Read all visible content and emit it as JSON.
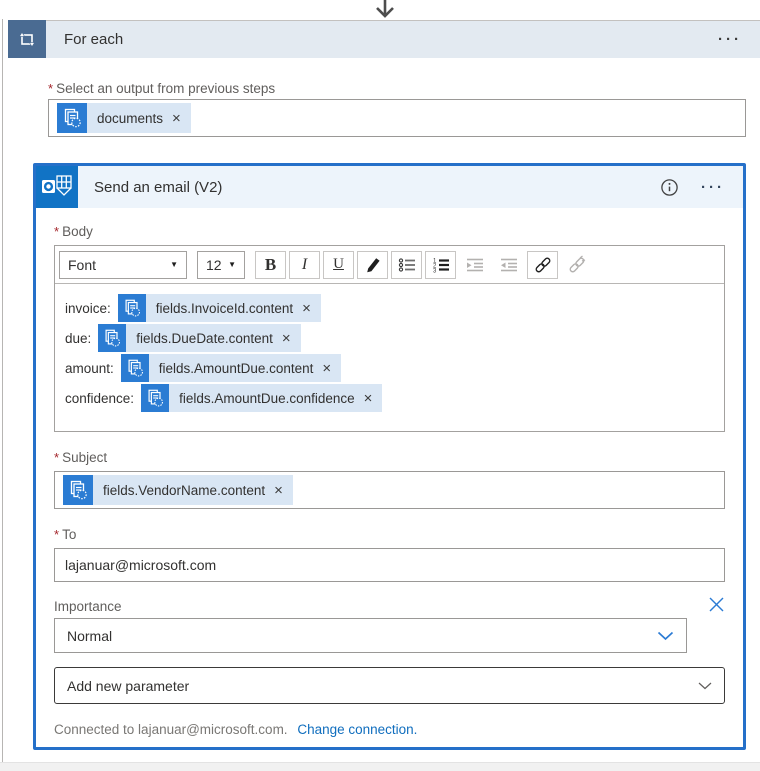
{
  "glyphs": {
    "caret_down": "▼",
    "ellipsis": "···",
    "dismiss": "×",
    "required": "*"
  },
  "for_each": {
    "title": "For each",
    "output_label": "Select an output from previous steps",
    "token": {
      "label": "documents"
    }
  },
  "email_card": {
    "title": "Send an email (V2)",
    "body": {
      "label": "Body",
      "toolbar": {
        "font": "Font",
        "size": "12",
        "bold": "B",
        "italic": "I",
        "underline": "U"
      },
      "lines": [
        {
          "prefix": "invoice:",
          "token": "fields.InvoiceId.content"
        },
        {
          "prefix": "due:",
          "token": "fields.DueDate.content"
        },
        {
          "prefix": "amount:",
          "token": "fields.AmountDue.content"
        },
        {
          "prefix": "confidence:",
          "token": "fields.AmountDue.confidence"
        }
      ]
    },
    "subject": {
      "label": "Subject",
      "token": "fields.VendorName.content"
    },
    "to": {
      "label": "To",
      "value": "lajanuar@microsoft.com"
    },
    "importance": {
      "label": "Importance",
      "value": "Normal"
    },
    "add_parameter_label": "Add new parameter",
    "footer": {
      "connected_text": "Connected to lajanuar@microsoft.com.",
      "change_link": "Change connection."
    }
  },
  "colors": {
    "accent_blue": "#2b7cd3",
    "card_border": "#2570c9",
    "foreach_icon_bg": "#4a6b92",
    "foreach_header_bg": "#e3eaf1",
    "outlook_blue": "#1173c5",
    "required_red": "#a4262c",
    "token_bg": "#d9e6f4",
    "link_blue": "#106ebe"
  }
}
